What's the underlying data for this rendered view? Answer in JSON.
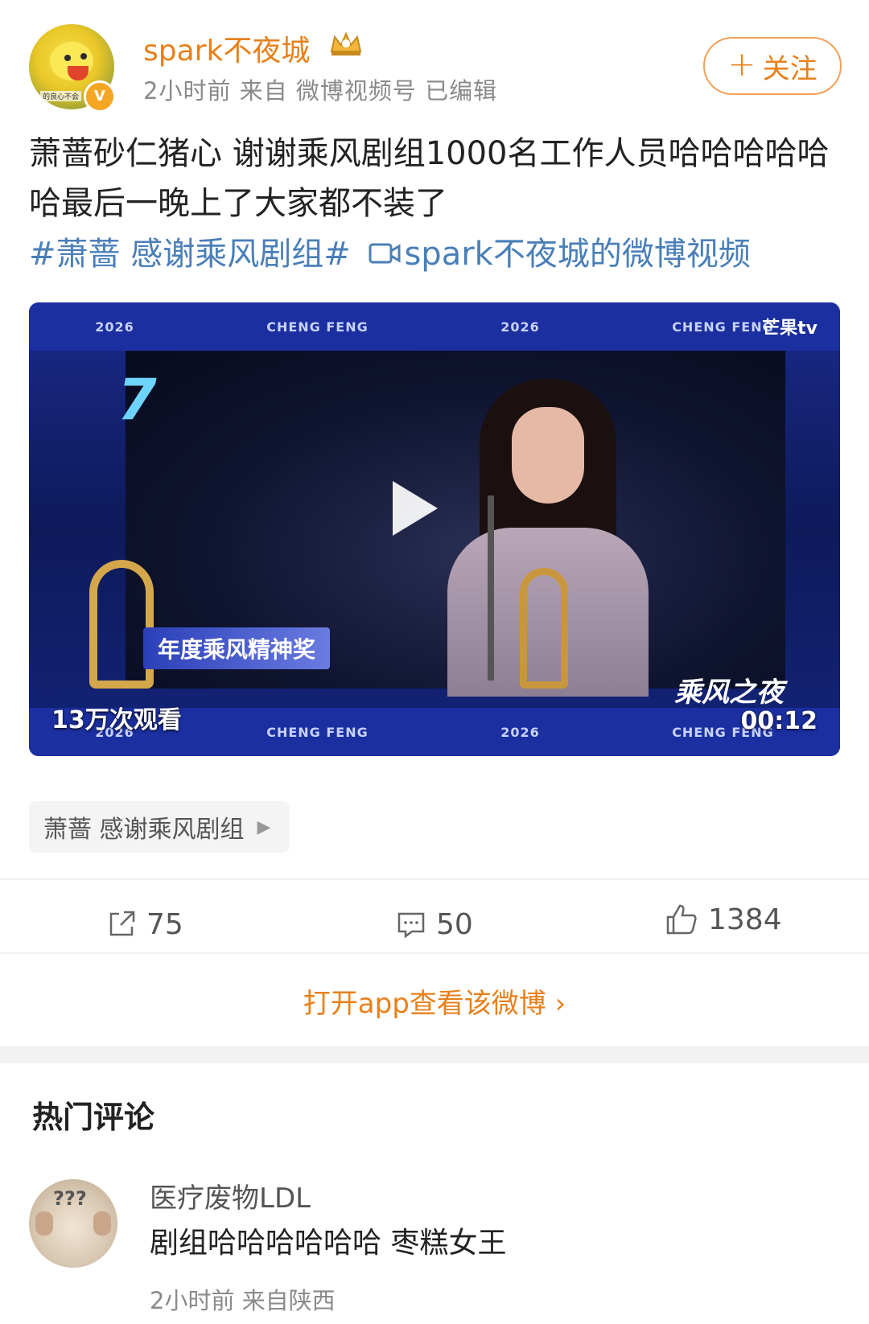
{
  "header": {
    "username": "spark不夜城",
    "meta": "2小时前  来自 微博视频号 已编辑",
    "follow_label": "关注"
  },
  "post": {
    "text": "萧蔷砂仁猪心 谢谢乘风剧组1000名工作人员哈哈哈哈哈哈最后一晚上了大家都不装了",
    "hashtag": "#萧蔷 感谢乘风剧组#",
    "video_link": "spark不夜城的微博视频"
  },
  "video": {
    "banner_items": [
      "2026",
      "CHENG FENG",
      "2026",
      "CHENG FENG"
    ],
    "brand": "芒果tv",
    "award": "年度乘风精神奖",
    "show_title": "乘风之夜",
    "views": "13万次观看",
    "duration": "00:12"
  },
  "topic_chip": {
    "label": "萧蔷 感谢乘风剧组"
  },
  "actions": {
    "repost": "75",
    "comment": "50",
    "like": "1384"
  },
  "open_app": "打开app查看该微博 ›",
  "comments": {
    "title": "热门评论",
    "items": [
      {
        "name": "医疗废物LDL",
        "text": "剧组哈哈哈哈哈哈 枣糕女王",
        "meta": "2小时前  来自陕西"
      }
    ]
  },
  "colors": {
    "accent": "#e8801a",
    "link": "#4a7fb8"
  }
}
